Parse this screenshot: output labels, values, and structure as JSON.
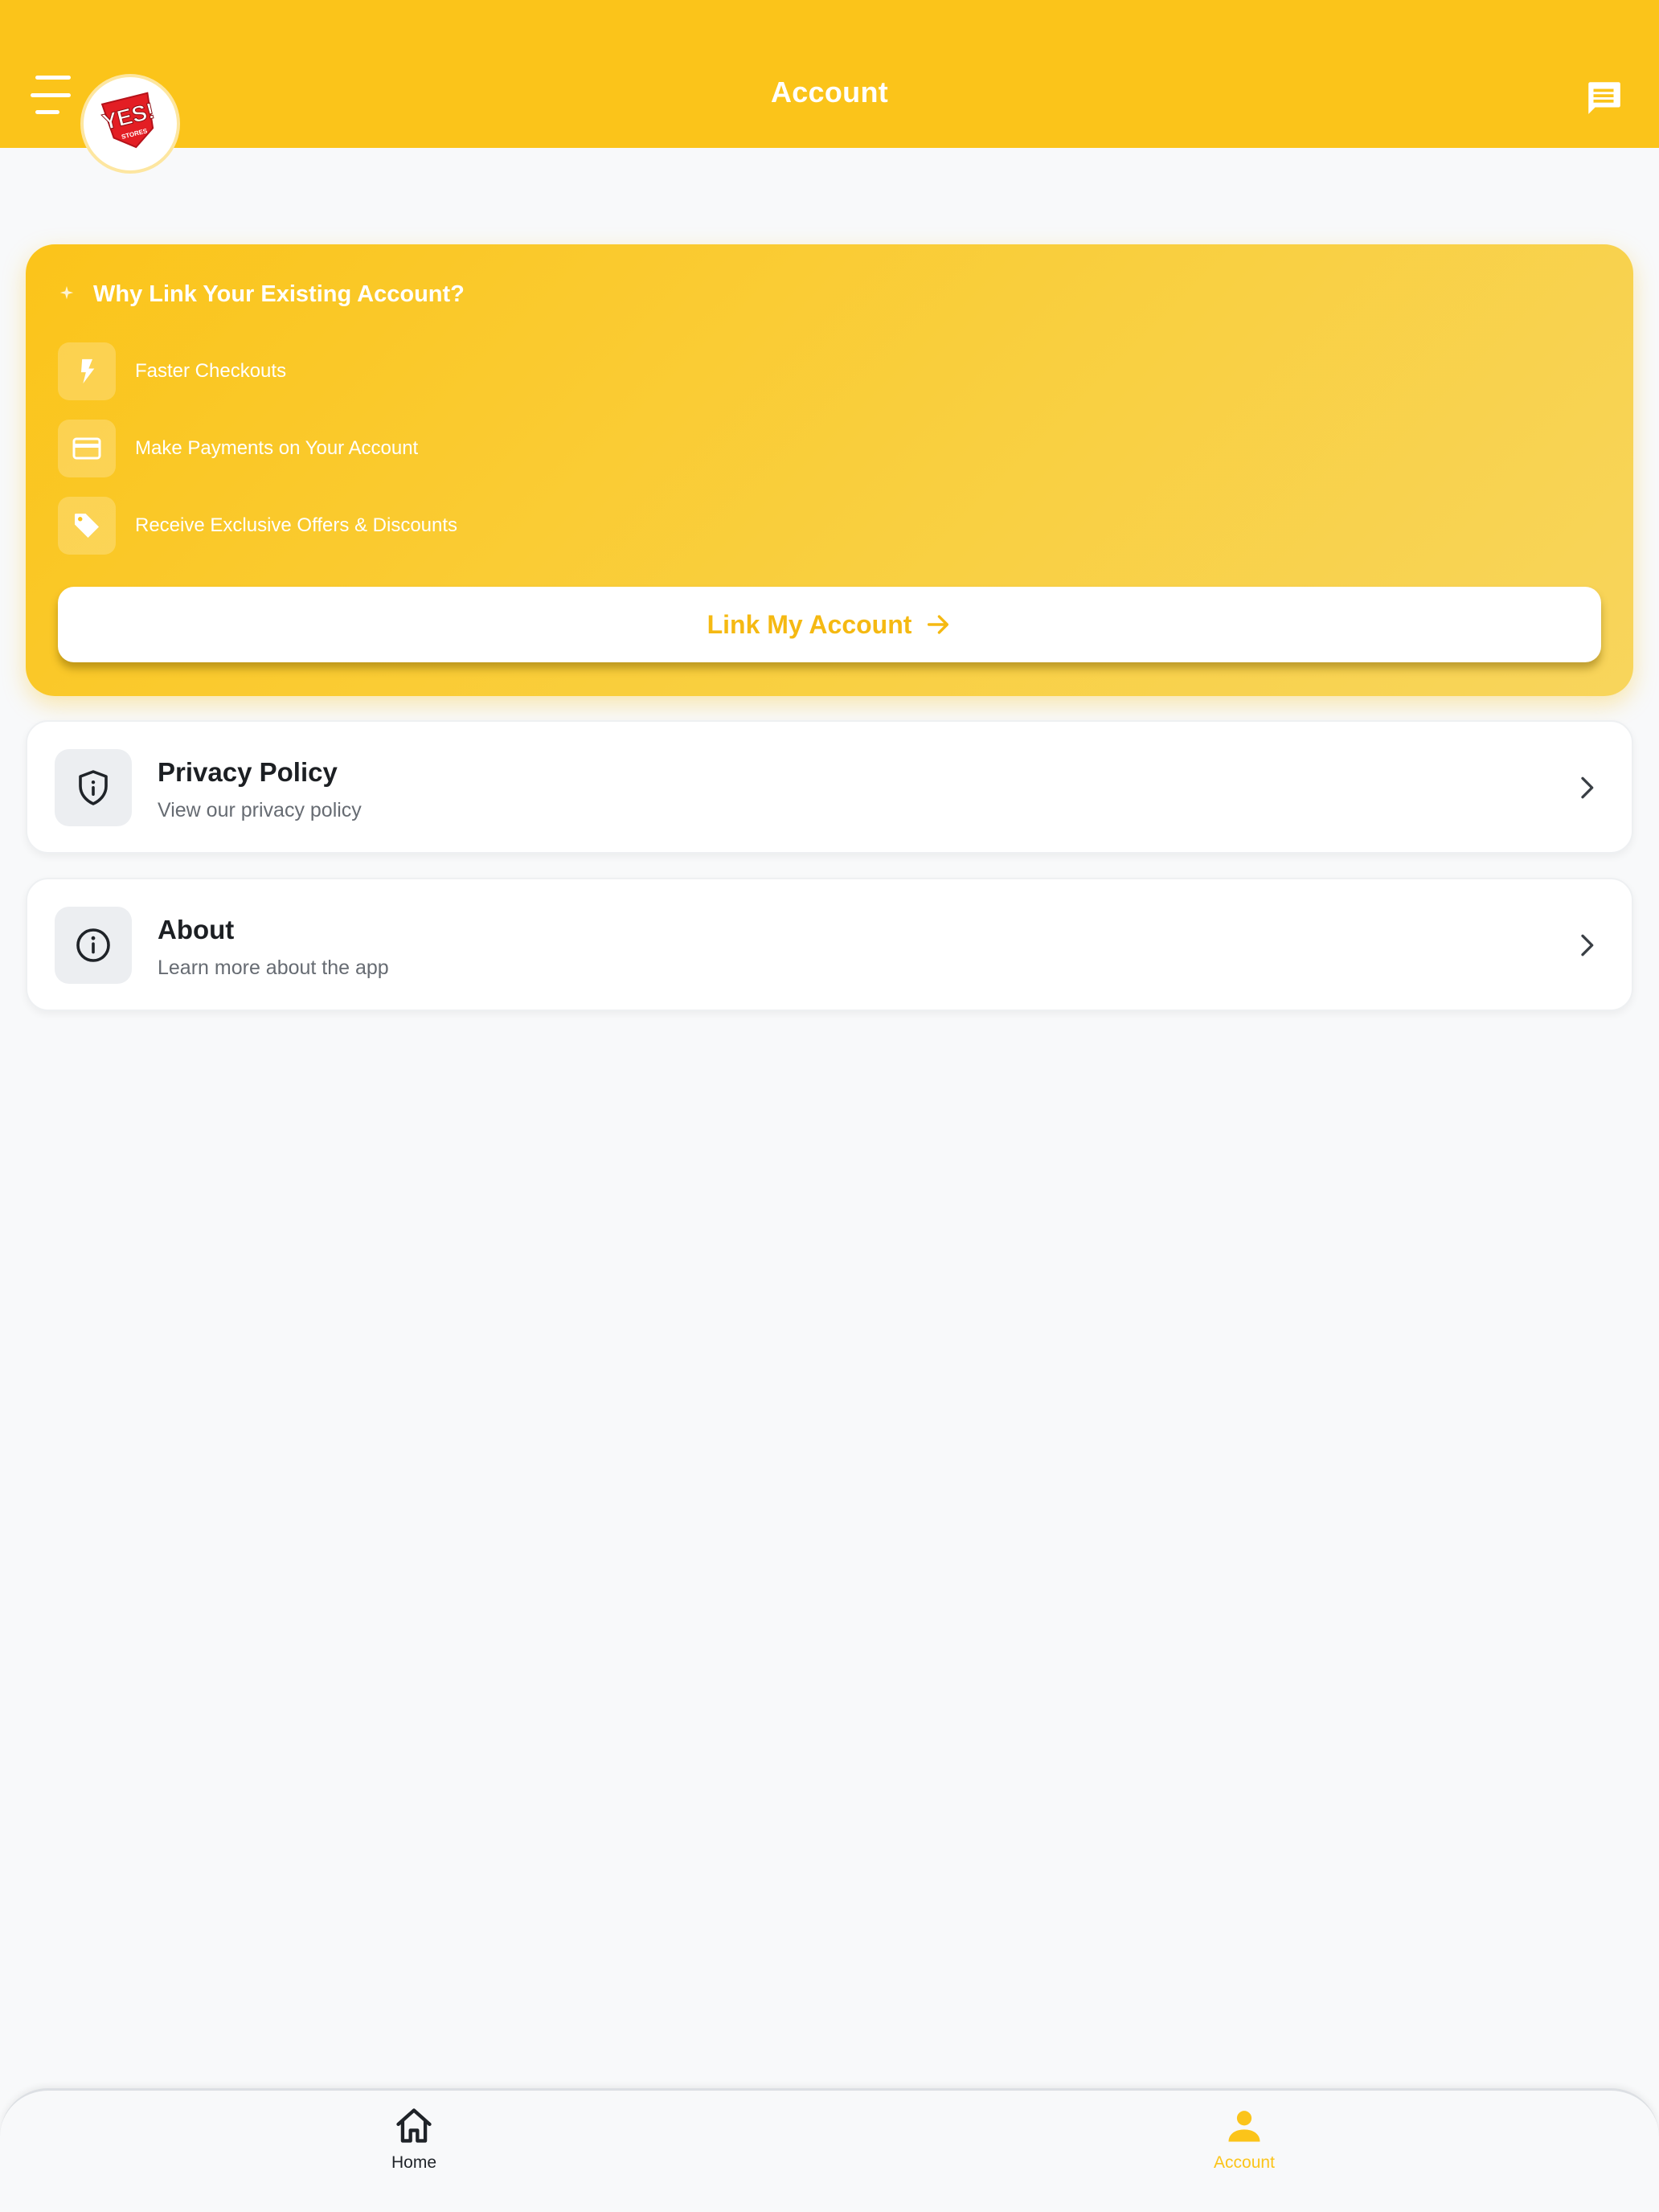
{
  "header": {
    "title": "Account",
    "logo_text": "YES!",
    "logo_subtext": "STORES"
  },
  "promo": {
    "title": "Why Link Your Existing Account?",
    "benefits": [
      {
        "label": "Faster Checkouts",
        "icon": "lightning-icon"
      },
      {
        "label": "Make Payments on Your Account",
        "icon": "credit-card-icon"
      },
      {
        "label": "Receive Exclusive Offers & Discounts",
        "icon": "tag-icon"
      }
    ],
    "button_label": "Link My Account"
  },
  "menu_items": [
    {
      "title": "Privacy Policy",
      "subtitle": "View our privacy policy",
      "icon": "shield-icon"
    },
    {
      "title": "About",
      "subtitle": "Learn more about the app",
      "icon": "info-icon"
    }
  ],
  "bottom_nav": {
    "items": [
      {
        "label": "Home",
        "icon": "home-icon",
        "active": false
      },
      {
        "label": "Account",
        "icon": "person-icon",
        "active": true
      }
    ]
  },
  "colors": {
    "brand": "#fbc41a",
    "button_text": "#f5b912",
    "background": "#f8f9fa",
    "logo_red": "#e31e24"
  }
}
